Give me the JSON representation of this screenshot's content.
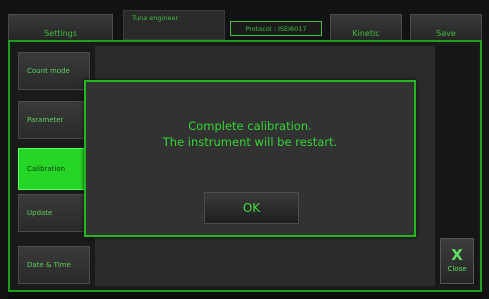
{
  "tabs": {
    "settings": "Settings",
    "small_tab": "Tuna engineer",
    "protocol": "Protocol : ISEI6017",
    "kinetic": "Kinetic",
    "save": "Save"
  },
  "sidebar": {
    "items": [
      {
        "label": "Count mode"
      },
      {
        "label": "Parameter"
      },
      {
        "label": "Calibration"
      },
      {
        "label": "Update"
      },
      {
        "label": "Date & Time"
      }
    ]
  },
  "dialog": {
    "line1": "Complete calibration.",
    "line2": "The instrument will be restart.",
    "ok_label": "OK"
  },
  "close": {
    "icon": "X",
    "label": "Close"
  },
  "colors": {
    "accent_green": "#26d626",
    "text_green": "#34d634",
    "frame_green": "#1f9f1f"
  }
}
